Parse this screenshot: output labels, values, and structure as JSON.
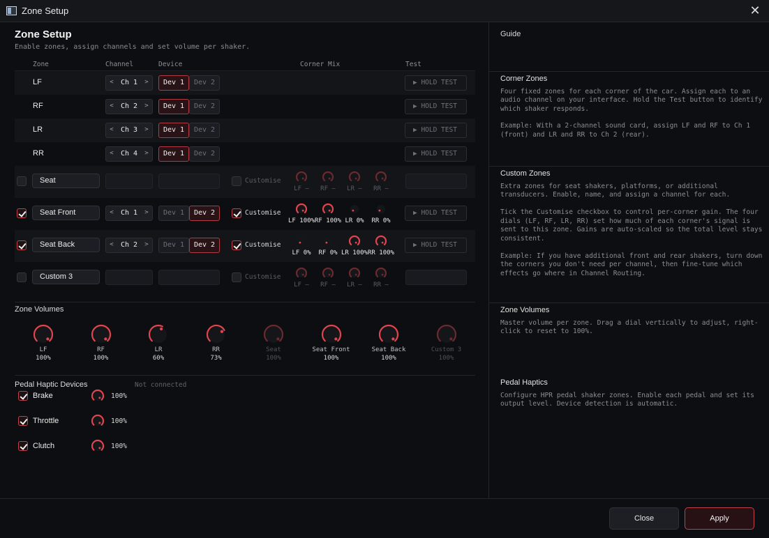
{
  "window": {
    "title": "Zone Setup",
    "close_glyph": "✕"
  },
  "header": {
    "title": "Zone Setup",
    "subtitle": "Enable zones, assign channels and set volume per shaker."
  },
  "columns": {
    "zone": "Zone",
    "channel": "Channel",
    "device": "Device",
    "corner_mix": "Corner Mix",
    "test": "Test"
  },
  "common": {
    "dev1": "Dev 1",
    "dev2": "Dev 2",
    "hold_test": "▶ HOLD TEST",
    "customise": "Customise",
    "prev": "<",
    "next": ">"
  },
  "corner_zones": [
    {
      "name": "LF",
      "channel": "Ch 1",
      "device": "Dev 1"
    },
    {
      "name": "RF",
      "channel": "Ch 2",
      "device": "Dev 1"
    },
    {
      "name": "LR",
      "channel": "Ch 3",
      "device": "Dev 1"
    },
    {
      "name": "RR",
      "channel": "Ch 4",
      "device": "Dev 1"
    }
  ],
  "custom_zones": [
    {
      "enabled": false,
      "name": "Seat",
      "customise": false,
      "mix": [
        {
          "c": "LF",
          "v": "—",
          "level": 1.0
        },
        {
          "c": "RF",
          "v": "—",
          "level": 1.0
        },
        {
          "c": "LR",
          "v": "—",
          "level": 1.0
        },
        {
          "c": "RR",
          "v": "—",
          "level": 1.0
        }
      ]
    },
    {
      "enabled": true,
      "name": "Seat Front",
      "channel": "Ch 1",
      "device": "Dev 2",
      "customise": true,
      "mix": [
        {
          "c": "LF",
          "v": "100%",
          "level": 1.0
        },
        {
          "c": "RF",
          "v": "100%",
          "level": 1.0
        },
        {
          "c": "LR",
          "v": "0%",
          "level": 0
        },
        {
          "c": "RR",
          "v": "0%",
          "level": 0
        }
      ]
    },
    {
      "enabled": true,
      "name": "Seat Back",
      "channel": "Ch 2",
      "device": "Dev 2",
      "customise": true,
      "mix": [
        {
          "c": "LF",
          "v": "0%",
          "level": 0
        },
        {
          "c": "RF",
          "v": "0%",
          "level": 0
        },
        {
          "c": "LR",
          "v": "100%",
          "level": 1.0
        },
        {
          "c": "RR",
          "v": "100%",
          "level": 1.0
        }
      ]
    },
    {
      "enabled": false,
      "name": "Custom 3",
      "customise": false,
      "mix": [
        {
          "c": "LF",
          "v": "—",
          "level": 1.0
        },
        {
          "c": "RF",
          "v": "—",
          "level": 1.0
        },
        {
          "c": "LR",
          "v": "—",
          "level": 1.0
        },
        {
          "c": "RR",
          "v": "—",
          "level": 1.0
        }
      ]
    }
  ],
  "zone_volumes": {
    "title": "Zone Volumes",
    "items": [
      {
        "name": "LF",
        "value": "100%",
        "level": 1.0,
        "enabled": true
      },
      {
        "name": "RF",
        "value": "100%",
        "level": 1.0,
        "enabled": true
      },
      {
        "name": "LR",
        "value": "60%",
        "level": 0.6,
        "enabled": true
      },
      {
        "name": "RR",
        "value": "73%",
        "level": 0.73,
        "enabled": true
      },
      {
        "name": "Seat",
        "value": "100%",
        "level": 1.0,
        "enabled": false
      },
      {
        "name": "Seat Front",
        "value": "100%",
        "level": 1.0,
        "enabled": true
      },
      {
        "name": "Seat Back",
        "value": "100%",
        "level": 1.0,
        "enabled": true
      },
      {
        "name": "Custom 3",
        "value": "100%",
        "level": 1.0,
        "enabled": false
      }
    ]
  },
  "pedals": {
    "title": "Pedal Haptic Devices",
    "status": "Not connected",
    "items": [
      {
        "name": "Brake",
        "enabled": true,
        "value": "100%",
        "level": 1.0
      },
      {
        "name": "Throttle",
        "enabled": true,
        "value": "100%",
        "level": 1.0
      },
      {
        "name": "Clutch",
        "enabled": true,
        "value": "100%",
        "level": 1.0
      }
    ]
  },
  "guide": {
    "title": "Guide",
    "sections": [
      {
        "title": "Corner Zones",
        "paras": [
          "Four fixed zones for each corner of the car. Assign each to an audio channel on your interface. Hold the Test button to identify which shaker responds.",
          "Example: With a 2-channel sound card, assign LF and RF to Ch 1 (front) and LR and RR to Ch 2 (rear)."
        ]
      },
      {
        "title": "Custom Zones",
        "paras": [
          "Extra zones for seat shakers, platforms, or additional transducers. Enable, name, and assign a channel for each.",
          "Tick the Customise checkbox to control per-corner gain. The four dials (LF, RF, LR, RR) set how much of each corner's signal is sent to this zone. Gains are auto-scaled so the total level stays consistent.",
          "Example: If you have additional front and rear shakers, turn down the corners you don't need per channel, then fine-tune which effects go where in Channel Routing."
        ]
      },
      {
        "title": "Zone Volumes",
        "paras": [
          "Master volume per zone. Drag a dial vertically to adjust, right-click to reset to 100%."
        ]
      },
      {
        "title": "Pedal Haptics",
        "paras": [
          "Configure HPR pedal shaker zones. Enable each pedal and set its output level. Device detection is automatic."
        ]
      }
    ]
  },
  "footer": {
    "close": "Close",
    "apply": "Apply"
  },
  "colors": {
    "accent": "#e0444e",
    "accent_dim": "#6a2a2f",
    "bg": "#0d0e11"
  }
}
